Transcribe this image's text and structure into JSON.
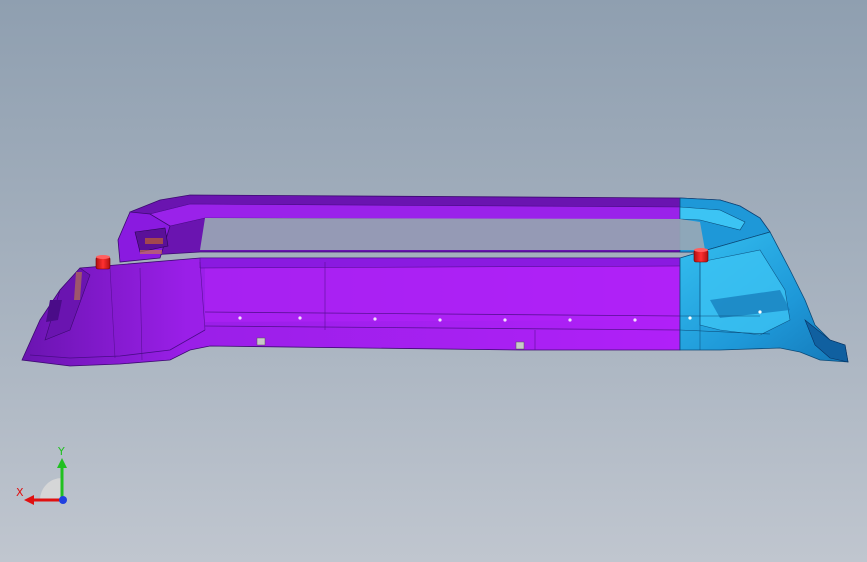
{
  "viewport": {
    "background_top": "#8f9fb0",
    "background_bottom": "#c0c6cf"
  },
  "model": {
    "primary_color": "#a020f0",
    "accent_color": "#2aa8e0",
    "marker_color": "#e02020"
  },
  "triad": {
    "x_label": "X",
    "y_label": "Y",
    "x_color": "#e01010",
    "y_color": "#20c020",
    "z_color": "#2040e0"
  }
}
